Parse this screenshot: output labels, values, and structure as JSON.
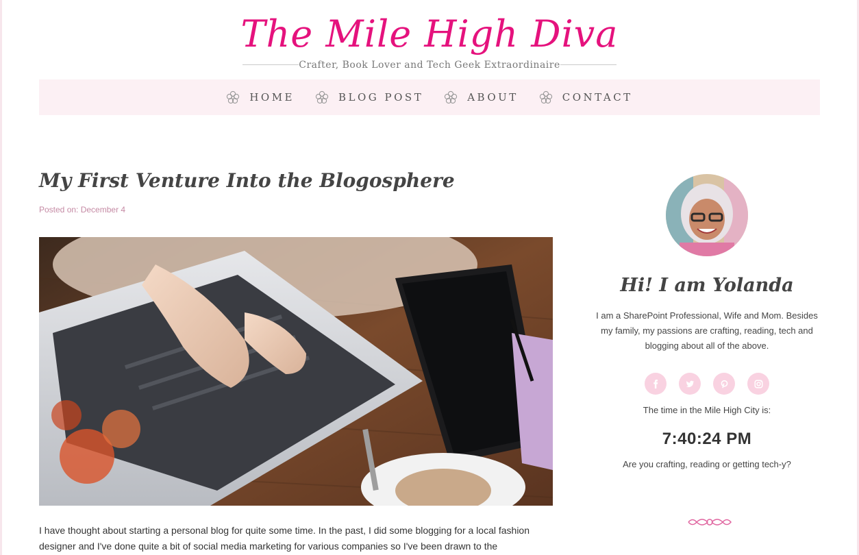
{
  "site": {
    "title": "The Mile High Diva",
    "tagline": "Crafter, Book Lover and Tech Geek Extraordinaire"
  },
  "nav": {
    "items": [
      {
        "label": "HOME",
        "icon": "flower-icon"
      },
      {
        "label": "BLOG POST",
        "icon": "flower-icon"
      },
      {
        "label": "ABOUT",
        "icon": "flower-icon"
      },
      {
        "label": "CONTACT",
        "icon": "flower-icon"
      }
    ]
  },
  "post": {
    "title": "My First Venture Into the Blogosphere",
    "meta": "Posted on: December 4",
    "image": "laptop-and-tablet-on-wooden-desk-photo",
    "body": "I have thought about starting a personal blog for quite some time. In the past, I did some blogging for a local fashion designer and I've done quite a bit of social media marketing for various companies so I've been drawn to the"
  },
  "sidebar": {
    "avatar": "profile-photo",
    "greeting": "Hi! I am Yolanda",
    "bio": "I am a SharePoint Professional, Wife and Mom. Besides my family, my passions are crafting, reading, tech and blogging about all of the above.",
    "social": [
      {
        "icon": "facebook-icon"
      },
      {
        "icon": "twitter-icon"
      },
      {
        "icon": "pinterest-icon"
      },
      {
        "icon": "instagram-icon"
      }
    ],
    "time_label": "The time in the Mile High City is:",
    "clock": "7:40:24 PM",
    "question": "Are you crafting, reading or getting tech-y?"
  },
  "colors": {
    "accent": "#e5127d",
    "nav_bg": "#fcf0f4",
    "social_bg": "#f9d2e1",
    "meta": "#c58aa4"
  }
}
